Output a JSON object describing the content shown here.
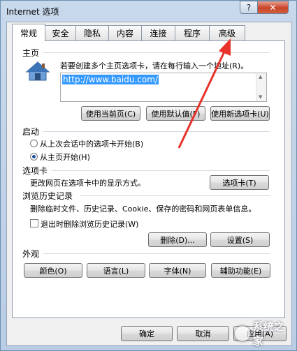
{
  "window": {
    "title": "Internet 选项",
    "help_label": "?",
    "close_label": "✕"
  },
  "tabs": [
    {
      "label": "常规"
    },
    {
      "label": "安全"
    },
    {
      "label": "隐私"
    },
    {
      "label": "内容"
    },
    {
      "label": "连接"
    },
    {
      "label": "程序"
    },
    {
      "label": "高级"
    }
  ],
  "home": {
    "heading": "主页",
    "description": "若要创建多个主页选项卡，请在每行输入一个地址(R)。",
    "url": "http://www.baidu.com/",
    "use_current": "使用当前页(C)",
    "use_default": "使用默认值(F)",
    "use_new_tab": "使用新选项卡(U)",
    "icon": "house-icon"
  },
  "startup": {
    "heading": "启动",
    "option_last_session": "从上次会话中的选项卡开始(B)",
    "option_home": "从主页开始(H)",
    "selected": "option_home"
  },
  "tabs_section": {
    "heading": "选项卡",
    "description": "更改网页在选项卡中的显示方式。",
    "button": "选项卡(T)"
  },
  "history": {
    "heading": "浏览历史记录",
    "description": "删除临时文件、历史记录、Cookie、保存的密码和网页表单信息。",
    "delete_on_exit": "退出时删除浏览历史记录(W)",
    "delete_on_exit_checked": false,
    "delete_button": "删除(D)...",
    "settings_button": "设置(S)"
  },
  "appearance": {
    "heading": "外观",
    "colors": "颜色(O)",
    "languages": "语言(L)",
    "fonts": "字体(N)",
    "accessibility": "辅助功能(E)"
  },
  "footer": {
    "ok": "确定",
    "cancel": "取消",
    "apply": "应用(A)"
  },
  "annotation": {
    "arrow_color": "#e8322b",
    "watermark_text": "系统之家"
  }
}
